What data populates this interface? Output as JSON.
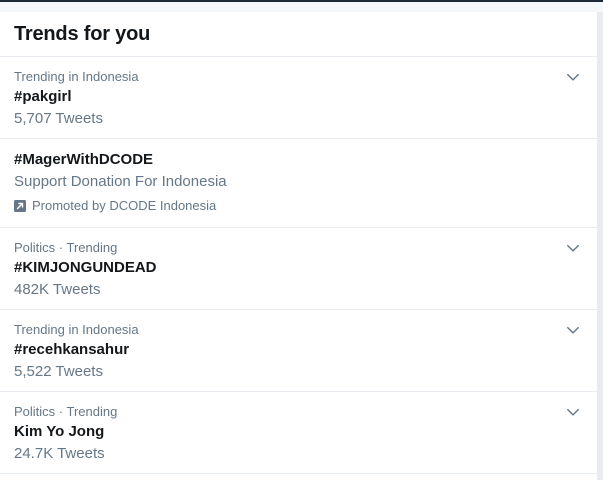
{
  "header": {
    "title": "Trends for you"
  },
  "trends": [
    {
      "context": "Trending in Indonesia",
      "name": "#pakgirl",
      "count": "5,707 Tweets"
    },
    {
      "name": "#MagerWithDCODE",
      "description": "Support Donation For Indonesia",
      "promoted_by": "Promoted by DCODE Indonesia"
    },
    {
      "context": "Politics · Trending",
      "name": "#KIMJONGUNDEAD",
      "count": "482K Tweets"
    },
    {
      "context": "Trending in Indonesia",
      "name": "#recehkansahur",
      "count": "5,522 Tweets"
    },
    {
      "context": "Politics · Trending",
      "name": "Kim Yo Jong",
      "count": "24.7K Tweets"
    }
  ],
  "icons": {
    "chevron": "chevron-down-icon",
    "promoted": "promoted-icon"
  },
  "colors": {
    "primary_text": "#14171a",
    "secondary_text": "#657786",
    "divider": "#e6ecf0",
    "background": "#ffffff"
  }
}
